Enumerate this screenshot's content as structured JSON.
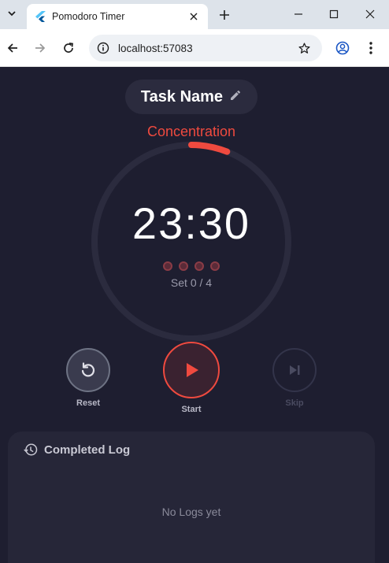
{
  "browser": {
    "tab_title": "Pomodoro Timer",
    "url": "localhost:57083"
  },
  "app": {
    "task_name": "Task Name",
    "mode_label": "Concentration",
    "timer_display": "23:30",
    "session_progress": 0.06,
    "set_label": "Set 0 / 4",
    "session_dots_total": 4,
    "controls": {
      "reset_label": "Reset",
      "start_label": "Start",
      "skip_label": "Skip"
    },
    "log": {
      "title": "Completed Log",
      "empty_text": "No Logs yet"
    }
  },
  "colors": {
    "background": "#1e1e30",
    "accent": "#ef4a3f",
    "card": "#262638"
  }
}
